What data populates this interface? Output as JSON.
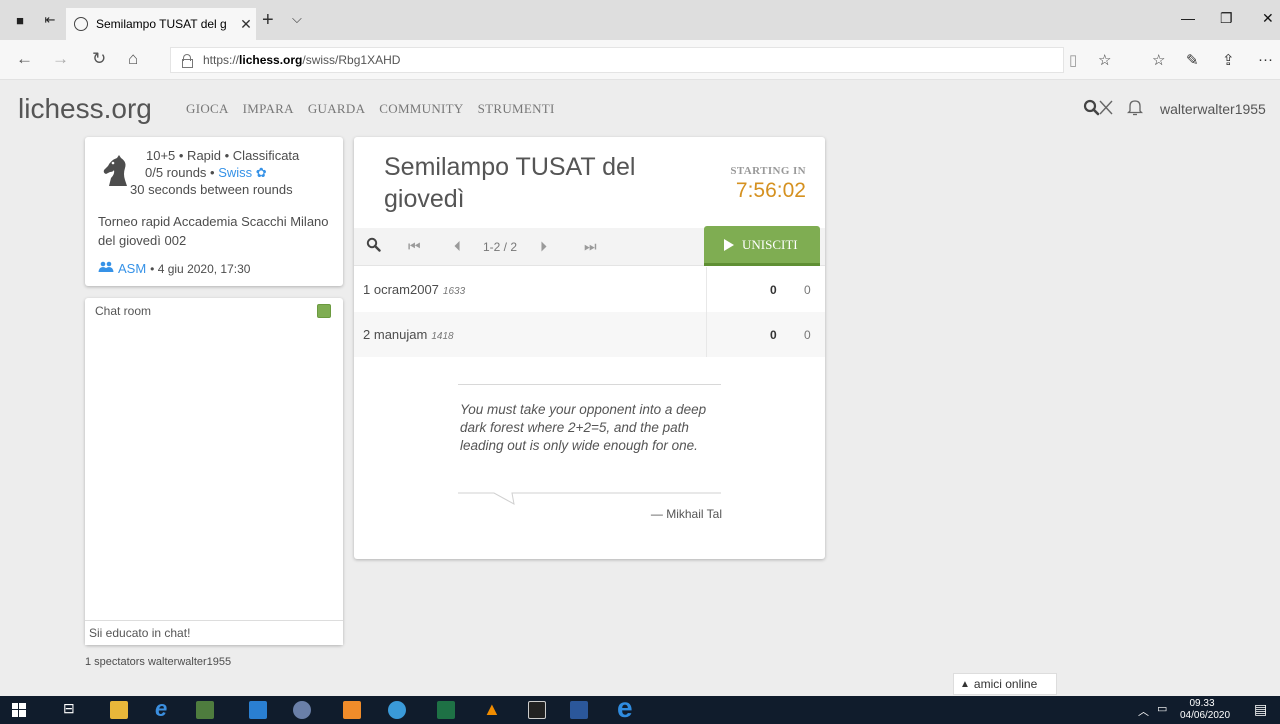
{
  "browser": {
    "tab_title": "Semilampo TUSAT del g",
    "url_prefix": "https://",
    "url_domain": "lichess.org",
    "url_path": "/swiss/Rbg1XAHD"
  },
  "header": {
    "logo_main": "lichess",
    "logo_tld": ".org",
    "nav": [
      "GIOCA",
      "IMPARA",
      "GUARDA",
      "COMMUNITY",
      "STRUMENTI"
    ],
    "username": "walterwalter1955"
  },
  "info": {
    "line1": "10+5 • Rapid • Classificata",
    "line2_prefix": "0/5 rounds • ",
    "line2_link": "Swiss",
    "line3": "30 seconds between rounds",
    "description": "Torneo rapid Accademia Scacchi Milano del giovedì 002",
    "team": "ASM",
    "date": " • 4 giu 2020, 17:30"
  },
  "chat": {
    "title": "Chat room",
    "placeholder": "Sii educato in chat!"
  },
  "spectators": "1 spectators walterwalter1955",
  "tournament": {
    "title": "Semilampo TUSAT del giovedì",
    "starting_label": "STARTING IN",
    "countdown": "7:56:02",
    "pager": "1-2 / 2",
    "join_label": "UNISCITI",
    "players": [
      {
        "rank": "1",
        "name": "ocram2007",
        "rating": "1633",
        "points": "0",
        "tiebreak": "0"
      },
      {
        "rank": "2",
        "name": "manujam",
        "rating": "1418",
        "points": "0",
        "tiebreak": "0"
      }
    ]
  },
  "quote": {
    "text": "You must take your opponent into a deep dark forest where 2+2=5, and the path leading out is only wide enough for one.",
    "author": "— Mikhail Tal"
  },
  "friends": "amici online",
  "taskbar": {
    "time": "09.33",
    "date": "04/06/2020"
  },
  "colors": {
    "accent_green": "#7fad52",
    "link_blue": "#3692e7",
    "clock_orange": "#d59120"
  }
}
